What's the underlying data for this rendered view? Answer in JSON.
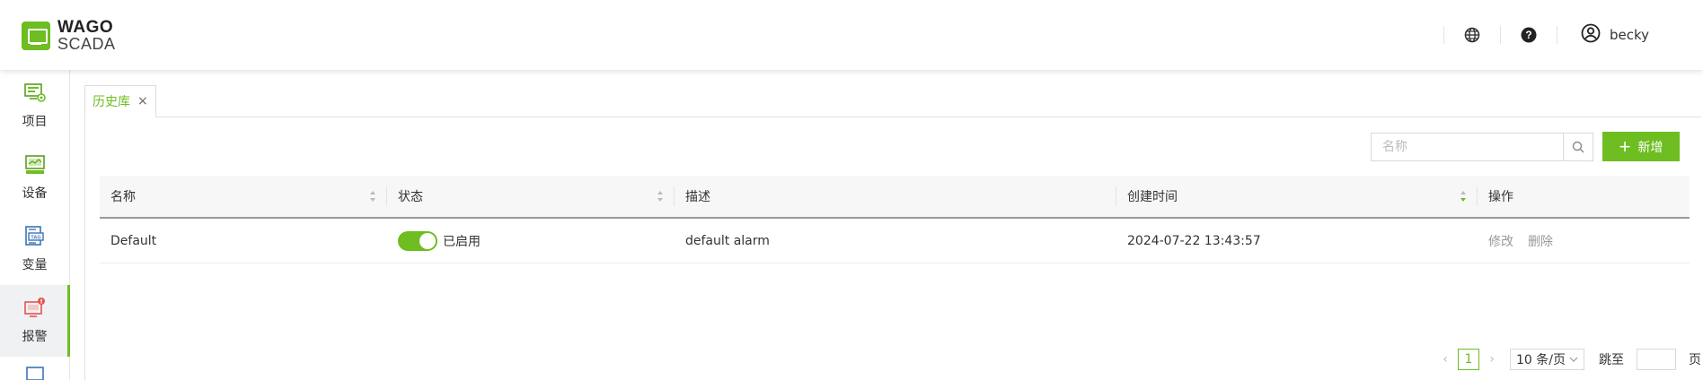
{
  "header": {
    "logo_line1": "WAGO",
    "logo_line2": "SCADA",
    "username": "becky",
    "icons": [
      "globe-icon",
      "help-icon",
      "user-icon"
    ]
  },
  "sidebar": {
    "items": [
      {
        "label": "项目",
        "icon": "project-icon",
        "active": false
      },
      {
        "label": "设备",
        "icon": "device-icon",
        "active": false
      },
      {
        "label": "变量",
        "icon": "tag-icon",
        "active": false
      },
      {
        "label": "报警",
        "icon": "alarm-icon",
        "active": true
      }
    ]
  },
  "tabs": [
    {
      "label": "历史库",
      "close": "×"
    }
  ],
  "toolbar": {
    "search_placeholder": "名称",
    "add_label": "新增"
  },
  "table": {
    "columns": [
      "名称",
      "状态",
      "描述",
      "创建时间",
      "操作"
    ],
    "rows": [
      {
        "name": "Default",
        "status": "已启用",
        "enabled": true,
        "description": "default alarm",
        "created": "2024-07-22 13:43:57",
        "actions": [
          "修改",
          "删除"
        ]
      }
    ]
  },
  "pagination": {
    "prev": "‹",
    "current": "1",
    "next": "›",
    "page_size": "10 条/页",
    "jump_label": "跳至",
    "page_suffix": "页"
  },
  "colors": {
    "accent": "#6ebd21",
    "alarm_icon": "#e2564f"
  }
}
